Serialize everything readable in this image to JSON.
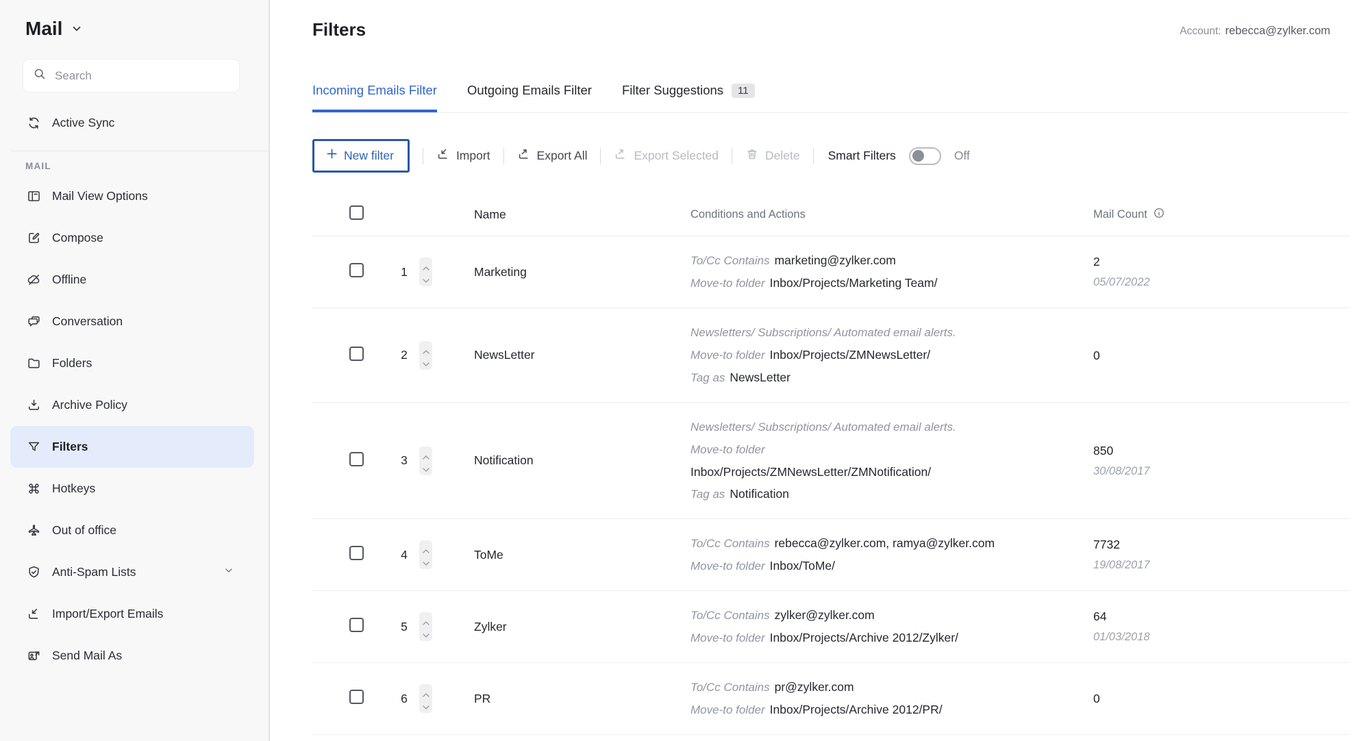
{
  "colors": {
    "accent_blue": "#2f65cf",
    "button_border_blue": "#2a57a6",
    "sidebar_active_bg": "#e4ecfb",
    "sidebar_bg": "#f8f8f9",
    "badge_bg": "#e5e5e8"
  },
  "sidebar": {
    "title": "Mail",
    "search_placeholder": "Search",
    "active_sync_label": "Active Sync",
    "active_sync_icon": "sync-icon",
    "section_label": "MAIL",
    "items": [
      {
        "label": "Mail View Options",
        "icon": "mail-view-icon",
        "active": false,
        "expandable": false
      },
      {
        "label": "Compose",
        "icon": "compose-icon",
        "active": false,
        "expandable": false
      },
      {
        "label": "Offline",
        "icon": "offline-icon",
        "active": false,
        "expandable": false
      },
      {
        "label": "Conversation",
        "icon": "conversation-icon",
        "active": false,
        "expandable": false
      },
      {
        "label": "Folders",
        "icon": "folder-icon",
        "active": false,
        "expandable": false
      },
      {
        "label": "Archive Policy",
        "icon": "archive-icon",
        "active": false,
        "expandable": false
      },
      {
        "label": "Filters",
        "icon": "filter-funnel-icon",
        "active": true,
        "expandable": false
      },
      {
        "label": "Hotkeys",
        "icon": "command-icon",
        "active": false,
        "expandable": false
      },
      {
        "label": "Out of office",
        "icon": "airplane-icon",
        "active": false,
        "expandable": false
      },
      {
        "label": "Anti-Spam Lists",
        "icon": "shield-check-icon",
        "active": false,
        "expandable": true
      },
      {
        "label": "Import/Export Emails",
        "icon": "import-export-icon",
        "active": false,
        "expandable": false
      },
      {
        "label": "Send Mail As",
        "icon": "send-mail-as-icon",
        "active": false,
        "expandable": false
      }
    ]
  },
  "header": {
    "title": "Filters",
    "account_label": "Account:",
    "account_email": "rebecca@zylker.com"
  },
  "tabs": [
    {
      "label": "Incoming Emails Filter",
      "active": true
    },
    {
      "label": "Outgoing Emails Filter",
      "active": false
    },
    {
      "label": "Filter Suggestions",
      "active": false,
      "badge": "11"
    }
  ],
  "toolbar": {
    "new_filter_label": "New filter",
    "import_label": "Import",
    "export_all_label": "Export All",
    "export_selected_label": "Export Selected",
    "delete_label": "Delete",
    "smart_filters_label": "Smart Filters",
    "toggle_state": "Off"
  },
  "table": {
    "headers": {
      "name": "Name",
      "conditions": "Conditions and Actions",
      "mail_count": "Mail Count"
    },
    "rows": [
      {
        "num": "1",
        "name": "Marketing",
        "lines": [
          {
            "label": "To/Cc Contains",
            "value": "marketing@zylker.com"
          },
          {
            "label": "Move-to folder",
            "value": "Inbox/Projects/Marketing Team/"
          }
        ],
        "count": "2",
        "date": "05/07/2022"
      },
      {
        "num": "2",
        "name": "NewsLetter",
        "lines": [
          {
            "label": "Newsletters/ Subscriptions/ Automated email alerts.",
            "value": ""
          },
          {
            "label": "Move-to folder",
            "value": "Inbox/Projects/ZMNewsLetter/"
          },
          {
            "label": "Tag as",
            "value": "NewsLetter"
          }
        ],
        "count": "0",
        "date": ""
      },
      {
        "num": "3",
        "name": "Notification",
        "lines": [
          {
            "label": "Newsletters/ Subscriptions/ Automated email alerts.",
            "value": ""
          },
          {
            "label": "Move-to folder",
            "value": ""
          },
          {
            "label": "",
            "value": "Inbox/Projects/ZMNewsLetter/ZMNotification/"
          },
          {
            "label": "Tag as",
            "value": "Notification"
          }
        ],
        "count": "850",
        "date": "30/08/2017"
      },
      {
        "num": "4",
        "name": "ToMe",
        "lines": [
          {
            "label": "To/Cc Contains",
            "value": "rebecca@zylker.com, ramya@zylker.com"
          },
          {
            "label": "Move-to folder",
            "value": "Inbox/ToMe/"
          }
        ],
        "count": "7732",
        "date": "19/08/2017"
      },
      {
        "num": "5",
        "name": "Zylker",
        "lines": [
          {
            "label": "To/Cc Contains",
            "value": "zylker@zylker.com"
          },
          {
            "label": "Move-to folder",
            "value": "Inbox/Projects/Archive 2012/Zylker/"
          }
        ],
        "count": "64",
        "date": "01/03/2018"
      },
      {
        "num": "6",
        "name": "PR",
        "lines": [
          {
            "label": "To/Cc Contains",
            "value": "pr@zylker.com"
          },
          {
            "label": "Move-to folder",
            "value": "Inbox/Projects/Archive 2012/PR/"
          }
        ],
        "count": "0",
        "date": ""
      }
    ]
  }
}
